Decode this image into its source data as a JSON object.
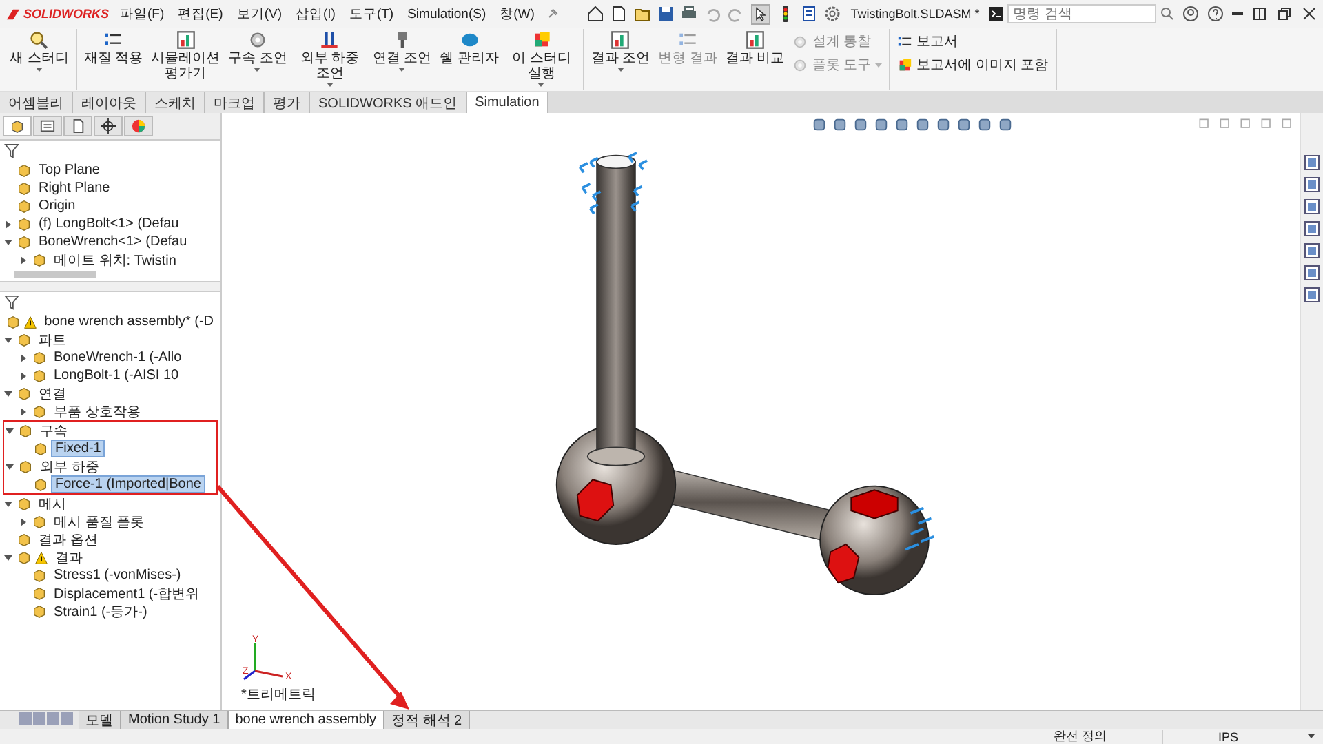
{
  "app": {
    "logo": "SOLIDWORKS"
  },
  "menu": [
    "파일(F)",
    "편집(E)",
    "보기(V)",
    "삽입(I)",
    "도구(T)",
    "Simulation(S)",
    "창(W)"
  ],
  "title": "TwistingBolt.SLDASM *",
  "search": {
    "placeholder": "명령 검색"
  },
  "ribbon": {
    "groups": [
      [
        {
          "kind": "large",
          "label": "새 스터디",
          "dropdown": true,
          "disabled": false
        }
      ],
      [
        {
          "kind": "large",
          "label": "재질 적용",
          "dropdown": false,
          "disabled": false
        },
        {
          "kind": "large",
          "label": "시뮬레이션 평가기",
          "dropdown": false,
          "disabled": false
        },
        {
          "kind": "large",
          "label": "구속 조언",
          "dropdown": true,
          "disabled": false
        },
        {
          "kind": "large",
          "label": "외부 하중 조언",
          "dropdown": true,
          "disabled": false
        },
        {
          "kind": "large",
          "label": "연결 조언",
          "dropdown": true,
          "disabled": false
        },
        {
          "kind": "large",
          "label": "쉘 관리자",
          "dropdown": false,
          "disabled": false
        },
        {
          "kind": "large",
          "label": "이 스터디 실행",
          "dropdown": true,
          "disabled": false
        }
      ],
      [
        {
          "kind": "large",
          "label": "결과 조언",
          "dropdown": true,
          "disabled": false
        },
        {
          "kind": "large",
          "label": "변형 결과",
          "dropdown": false,
          "disabled": true
        },
        {
          "kind": "large",
          "label": "결과 비교",
          "dropdown": false,
          "disabled": false
        },
        {
          "kind": "small",
          "label": "설계 통찰",
          "dropdown": false,
          "disabled": true
        },
        {
          "kind": "small",
          "label": "플롯 도구",
          "dropdown": true,
          "disabled": true
        }
      ],
      [
        {
          "kind": "small",
          "label": "보고서",
          "dropdown": false,
          "disabled": false
        },
        {
          "kind": "small",
          "label": "보고서에 이미지 포함",
          "dropdown": false,
          "disabled": false
        }
      ]
    ]
  },
  "tabs": [
    {
      "label": "어셈블리",
      "selected": false
    },
    {
      "label": "레이아웃",
      "selected": false
    },
    {
      "label": "스케치",
      "selected": false
    },
    {
      "label": "마크업",
      "selected": false
    },
    {
      "label": "평가",
      "selected": false
    },
    {
      "label": "SOLIDWORKS 애드인",
      "selected": false
    },
    {
      "label": "Simulation",
      "selected": true
    }
  ],
  "feature_tree": [
    {
      "label": "Top Plane"
    },
    {
      "label": "Right Plane"
    },
    {
      "label": "Origin"
    },
    {
      "label": "(f) LongBolt<1> (Defau",
      "expanded": false
    },
    {
      "label": "BoneWrench<1> (Defau",
      "expanded": true,
      "children": [
        {
          "label": "메이트 위치: Twistin",
          "expanded": false
        }
      ]
    }
  ],
  "study_tree": [
    {
      "label": "bone wrench assembly* (-D",
      "warning": true
    },
    {
      "label": "파트",
      "expanded": true,
      "children": [
        {
          "label": "BoneWrench-1 (-Allo",
          "expanded": false
        },
        {
          "label": "LongBolt-1 (-AISI 10",
          "expanded": false
        }
      ]
    },
    {
      "label": "연결",
      "expanded": true,
      "children": [
        {
          "label": "부품 상호작용",
          "expanded": false
        }
      ]
    },
    {
      "label": "구속",
      "expanded": true,
      "annotated": true,
      "children": [
        {
          "label": "Fixed-1",
          "selected": true
        }
      ]
    },
    {
      "label": "외부 하중",
      "expanded": true,
      "annotated": true,
      "children": [
        {
          "label": "Force-1 (Imported|Bone",
          "selected": true
        }
      ]
    },
    {
      "label": "메시",
      "expanded": true,
      "children": [
        {
          "label": "메시 품질 플롯",
          "expanded": false
        }
      ]
    },
    {
      "label": "결과 옵션"
    },
    {
      "label": "결과",
      "expanded": true,
      "warning": true,
      "children": [
        {
          "label": "Stress1 (-vonMises-)"
        },
        {
          "label": "Displacement1 (-합변위"
        },
        {
          "label": "Strain1 (-등가-)"
        }
      ]
    }
  ],
  "viewport": {
    "view_label": "*트리메트릭",
    "axes": [
      "Y",
      "X",
      "Z"
    ]
  },
  "bottom_tabs": [
    {
      "label": "모델",
      "selected": false
    },
    {
      "label": "Motion Study 1",
      "selected": false
    },
    {
      "label": "bone wrench assembly",
      "selected": true
    },
    {
      "label": "정적 해석 2",
      "selected": false
    }
  ],
  "status_bar": {
    "state": "완전 정의",
    "units": "IPS"
  }
}
